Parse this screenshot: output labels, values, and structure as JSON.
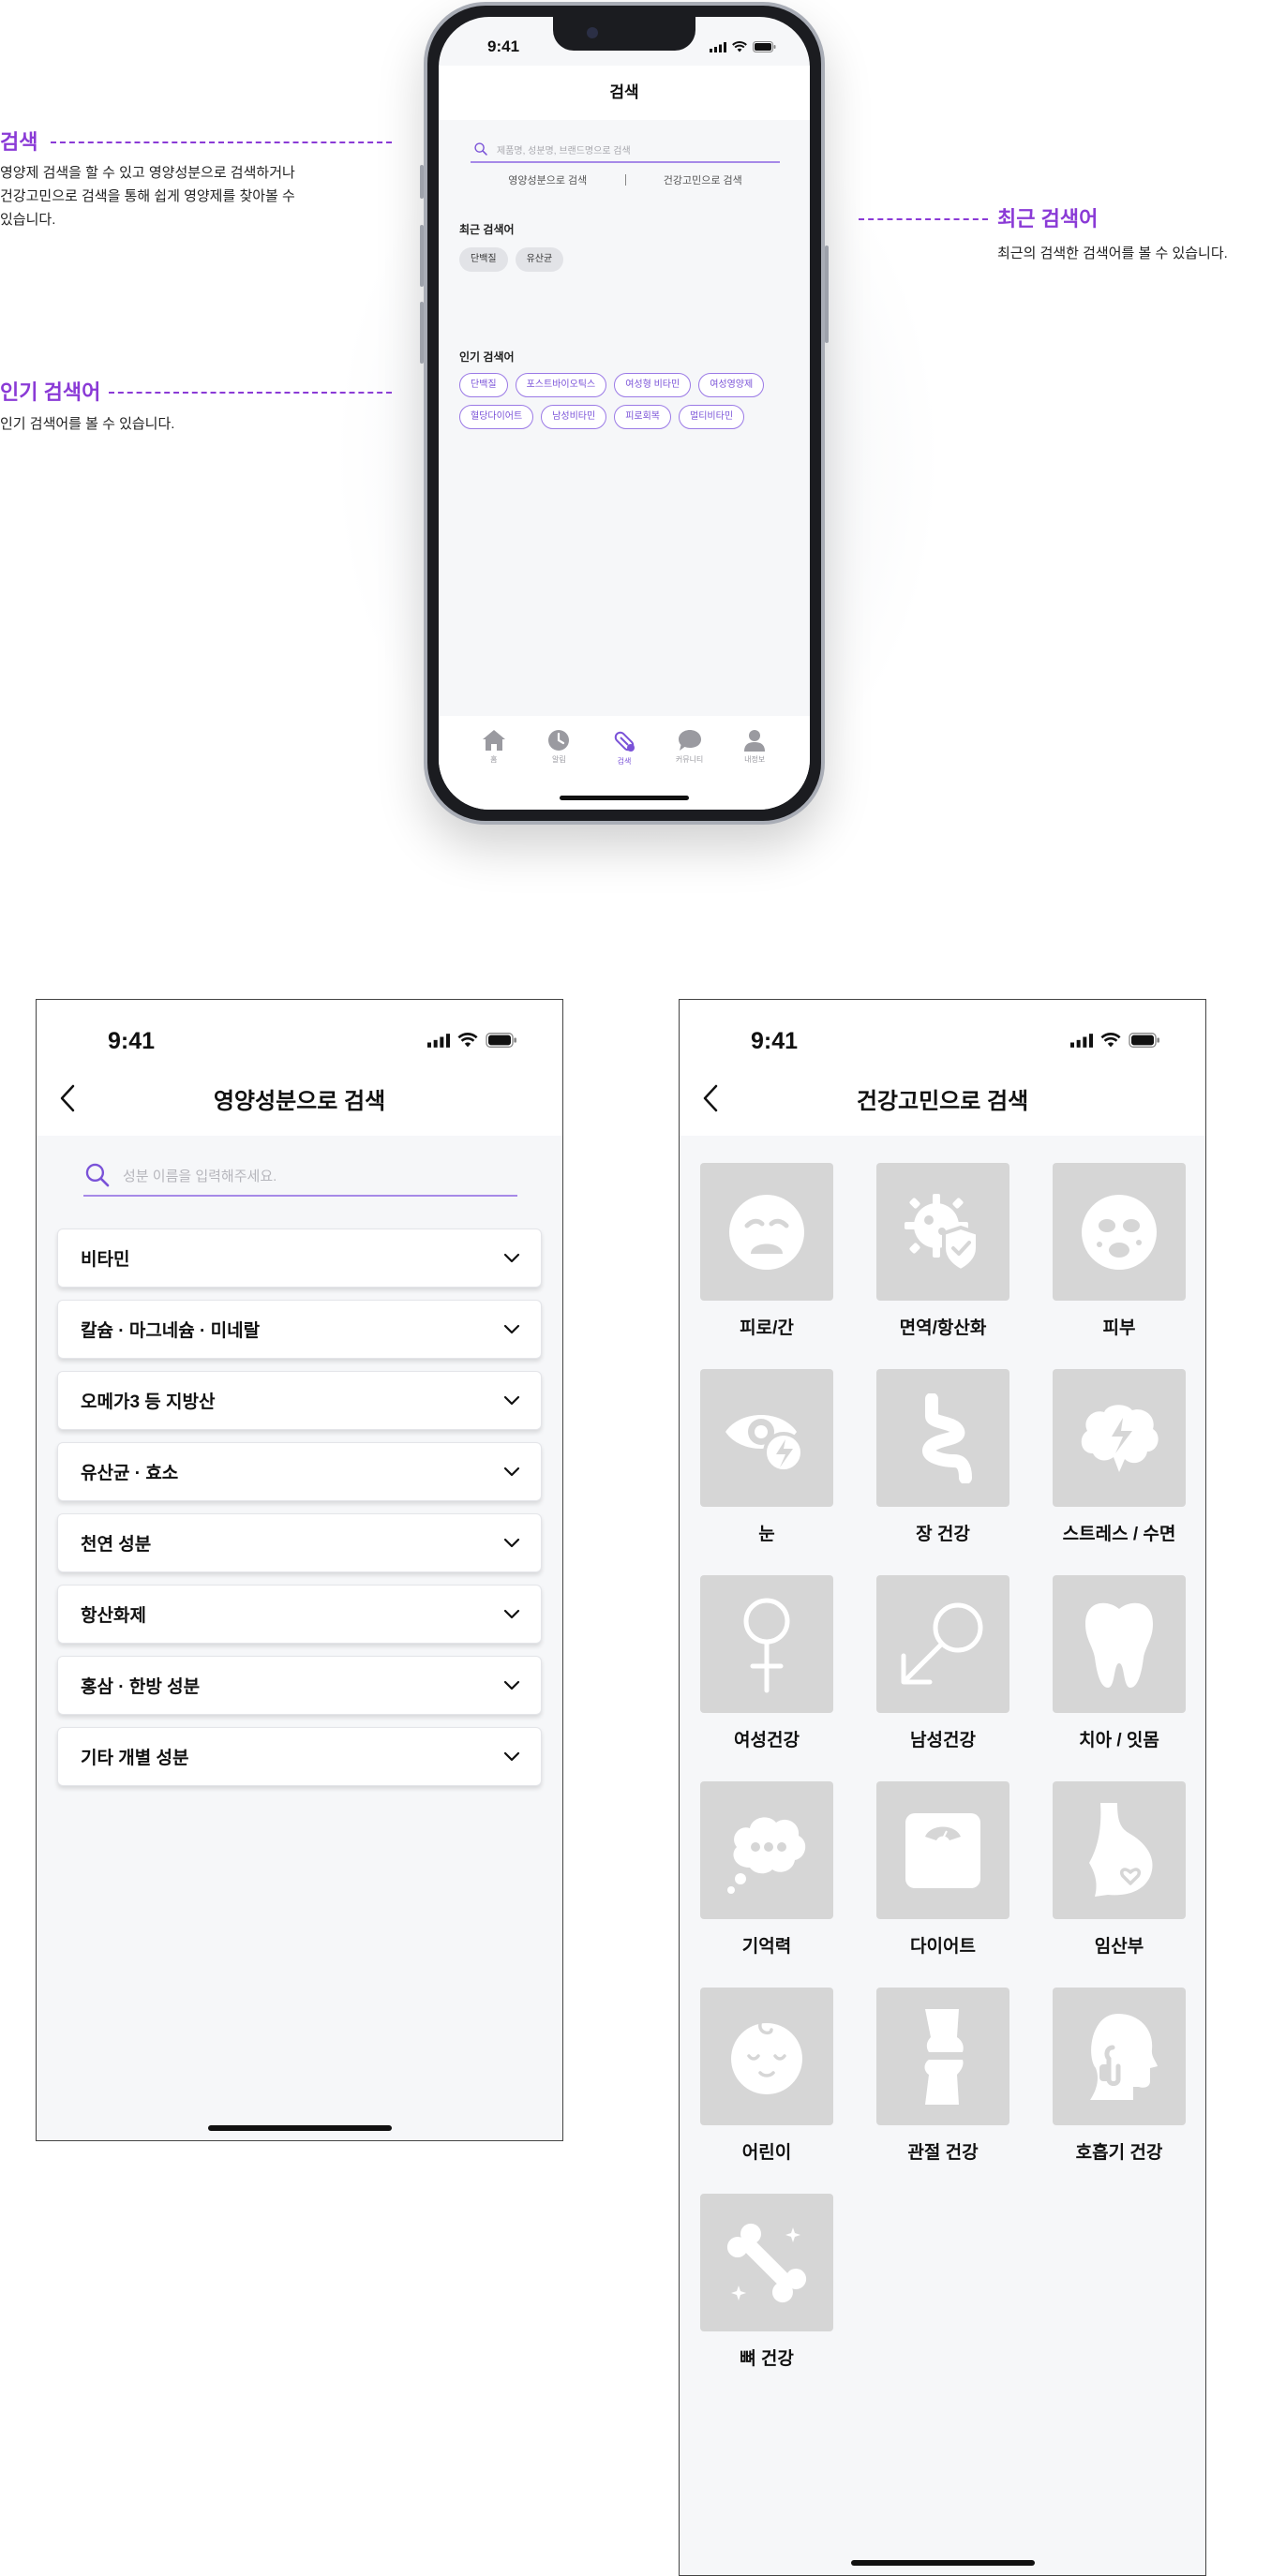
{
  "annotations": {
    "search": {
      "title": "검색",
      "lines": [
        "영양제 검색을 할 수 있고 영양성분으로 검색하거나",
        "건강고민으로 검색을 통해 쉽게 영양제를 찾아볼 수",
        "있습니다."
      ]
    },
    "popular": {
      "title": "인기 검색어",
      "lines": [
        "인기 검색어를 볼 수 있습니다."
      ]
    },
    "recent": {
      "title": "최근 검색어",
      "lines": [
        "최근의 검색한 검색어를 볼 수 있습니다."
      ]
    }
  },
  "search_screen": {
    "time": "9:41",
    "title": "검색",
    "search_placeholder": "제품명, 성분명, 브랜드명으로 검색",
    "tabs": [
      "영양성분으로 검색",
      "건강고민으로 검색"
    ],
    "recent_title": "최근 검색어",
    "recent": [
      "단백질",
      "유산균"
    ],
    "popular_title": "인기 검색어",
    "popular": [
      "단백질",
      "포스트바이오틱스",
      "여성형 비타민",
      "여성영양제",
      "혈당다이어트",
      "남성비타민",
      "피로회복",
      "멀티비타민"
    ],
    "nav": [
      {
        "label": "홈",
        "icon": "home-icon",
        "active": false
      },
      {
        "label": "알림",
        "icon": "clock-icon",
        "active": false
      },
      {
        "label": "검색",
        "icon": "pill-icon",
        "active": true
      },
      {
        "label": "커뮤니티",
        "icon": "chat-bubble-icon",
        "active": false
      },
      {
        "label": "내정보",
        "icon": "person-icon",
        "active": false
      }
    ]
  },
  "ingredient_screen": {
    "time": "9:41",
    "title": "영양성분으로 검색",
    "search_placeholder": "성분 이름을 입력해주세요.",
    "categories": [
      "비타민",
      "칼슘 · 마그네슘 · 미네랄",
      "오메가3 등 지방산",
      "유산균 · 효소",
      "천연 성분",
      "항산화제",
      "홍삼 · 한방 성분",
      "기타 개별 성분"
    ]
  },
  "concern_screen": {
    "time": "9:41",
    "title": "건강고민으로 검색",
    "categories": [
      {
        "label": "피로/간",
        "icon": "tired-face-icon"
      },
      {
        "label": "면역/항산화",
        "icon": "immune-shield-icon"
      },
      {
        "label": "피부",
        "icon": "face-mask-icon"
      },
      {
        "label": "눈",
        "icon": "eye-icon"
      },
      {
        "label": "장 건강",
        "icon": "intestine-icon"
      },
      {
        "label": "스트레스 / 수면",
        "icon": "brain-icon"
      },
      {
        "label": "여성건강",
        "icon": "female-symbol-icon"
      },
      {
        "label": "남성건강",
        "icon": "male-symbol-icon"
      },
      {
        "label": "치아 / 잇몸",
        "icon": "tooth-icon"
      },
      {
        "label": "기억력",
        "icon": "thought-bubble-icon"
      },
      {
        "label": "다이어트",
        "icon": "scale-icon"
      },
      {
        "label": "임산부",
        "icon": "pregnant-icon"
      },
      {
        "label": "어린이",
        "icon": "baby-face-icon"
      },
      {
        "label": "관절 건강",
        "icon": "knee-joint-icon"
      },
      {
        "label": "호흡기 건강",
        "icon": "respiratory-icon"
      },
      {
        "label": "뼈 건강",
        "icon": "bone-icon"
      }
    ]
  },
  "colors": {
    "accent": "#8a3ad6",
    "chip_purple": "#7a52d8",
    "tile_gray": "#d6d6d6",
    "background": "#f6f7f9"
  }
}
